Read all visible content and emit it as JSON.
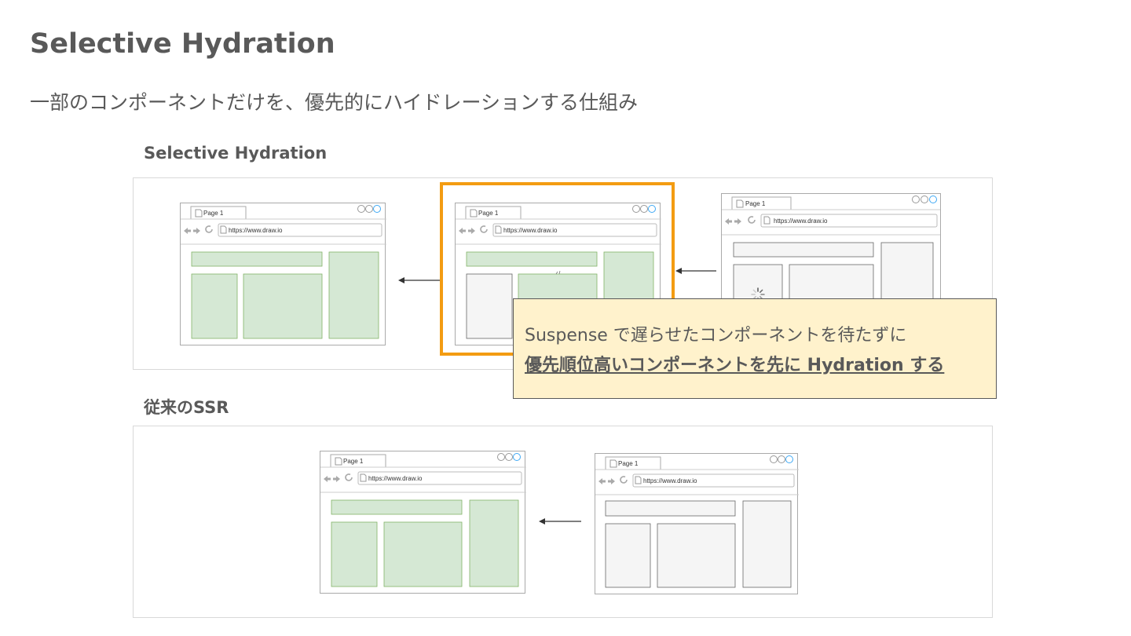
{
  "slide": {
    "title": "Selective Hydration",
    "subtitle": "一部のコンポーネントだけを、優先的にハイドレーションする仕組み"
  },
  "sections": {
    "selective": {
      "label": "Selective Hydration"
    },
    "traditional": {
      "label": "従来のSSR"
    }
  },
  "browser_mock": {
    "tab_label": "Page 1",
    "url": "https://www.draw.io"
  },
  "callout": {
    "line1": "Suspense で遅らせたコンポーネントを待たずに",
    "line2": "優先順位高いコンポーネントを先に Hydration する"
  },
  "colors": {
    "hydrated_fill": "#d5e8d4",
    "hydrated_stroke": "#82b366",
    "placeholder_fill": "#f5f5f5",
    "placeholder_stroke": "#666666",
    "highlight": "#f39c12",
    "callout_fill": "#fff2cc",
    "text": "#595959"
  },
  "icons": {
    "back": "arrow-left-icon",
    "forward": "arrow-right-icon",
    "reload": "reload-icon",
    "page": "page-icon",
    "spinner": "loading-spinner-icon"
  }
}
